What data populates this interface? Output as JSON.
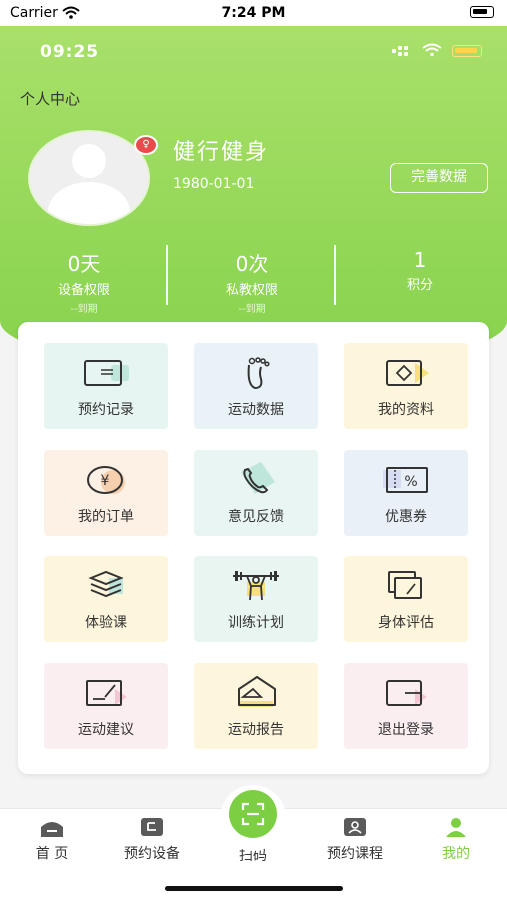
{
  "system_status": {
    "carrier": "Carrier",
    "time": "7:24 PM"
  },
  "inner_status": {
    "time": "09:25"
  },
  "header": {
    "title": "个人中心"
  },
  "profile": {
    "nickname": "健行健身",
    "birthday": "1980-01-01",
    "gender_symbol": "♀",
    "complete_button": "完善数据"
  },
  "stats": [
    {
      "value": "0天",
      "label": "设备权限",
      "sub": "--到期"
    },
    {
      "value": "0次",
      "label": "私教权限",
      "sub": "--到期"
    },
    {
      "value": "1",
      "label": "积分",
      "sub": ""
    }
  ],
  "grid": [
    {
      "label": "预约记录",
      "icon": "card-icon",
      "bg": "#e6f5f1"
    },
    {
      "label": "运动数据",
      "icon": "footprint-icon",
      "bg": "#e9f2f6"
    },
    {
      "label": "我的资料",
      "icon": "profile-card-icon",
      "bg": "#fdf6dc"
    },
    {
      "label": "我的订单",
      "icon": "yen-coin-icon",
      "bg": "#fdf0e4"
    },
    {
      "label": "意见反馈",
      "icon": "phone-icon",
      "bg": "#e8f5f3"
    },
    {
      "label": "优惠券",
      "icon": "coupon-icon",
      "bg": "#eaf0f8"
    },
    {
      "label": "体验课",
      "icon": "layers-icon",
      "bg": "#fdf6dc"
    },
    {
      "label": "训练计划",
      "icon": "weightlifting-icon",
      "bg": "#e8f5f1"
    },
    {
      "label": "身体评估",
      "icon": "assessment-icon",
      "bg": "#fdf6dc"
    },
    {
      "label": "运动建议",
      "icon": "suggestion-icon",
      "bg": "#fbeef1"
    },
    {
      "label": "运动报告",
      "icon": "report-envelope-icon",
      "bg": "#fdf6dc"
    },
    {
      "label": "退出登录",
      "icon": "logout-icon",
      "bg": "#fbeef1"
    }
  ],
  "tabs": [
    {
      "label": "首 页",
      "icon": "home-icon",
      "active": false
    },
    {
      "label": "预约设备",
      "icon": "device-icon",
      "active": false
    },
    {
      "label": "扫码",
      "icon": "scan-icon",
      "active": false
    },
    {
      "label": "预约课程",
      "icon": "course-icon",
      "active": false
    },
    {
      "label": "我的",
      "icon": "user-icon",
      "active": true
    }
  ],
  "colors": {
    "brand_green": "#7ccf43",
    "active_tab": "#7ccf43"
  }
}
